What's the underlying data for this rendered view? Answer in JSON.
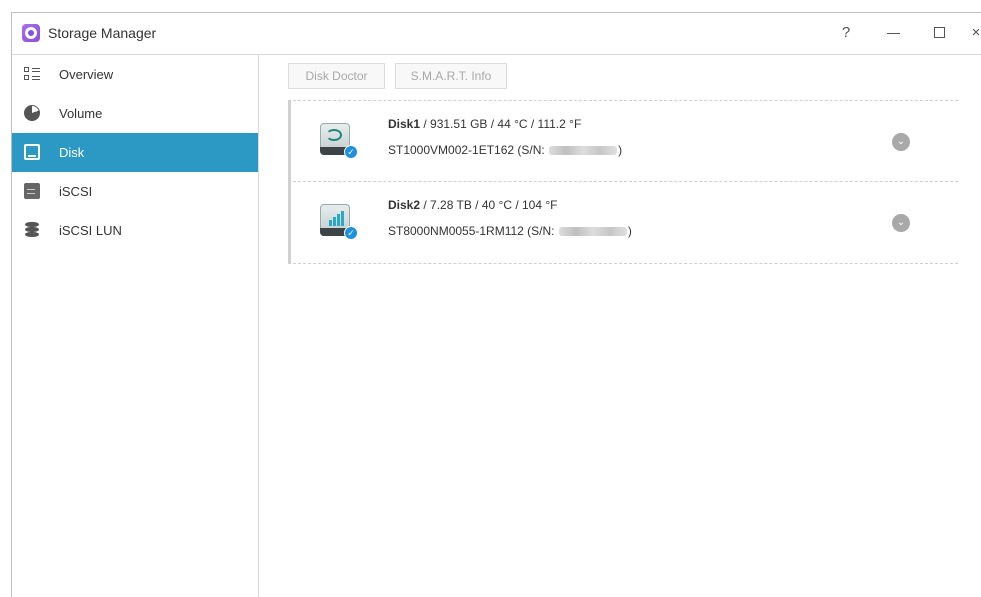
{
  "window": {
    "title": "Storage Manager",
    "controls": {
      "help": "?",
      "minimize": "",
      "maximize": "",
      "close": "×"
    }
  },
  "sidebar": {
    "items": [
      {
        "label": "Overview",
        "icon": "overview-icon",
        "active": false
      },
      {
        "label": "Volume",
        "icon": "volume-icon",
        "active": false
      },
      {
        "label": "Disk",
        "icon": "disk-icon",
        "active": true
      },
      {
        "label": "iSCSI",
        "icon": "iscsi-icon",
        "active": false
      },
      {
        "label": "iSCSI LUN",
        "icon": "iscsi-lun-icon",
        "active": false
      }
    ],
    "active_color": "#2c99c4"
  },
  "toolbar": {
    "disk_doctor": "Disk Doctor",
    "smart_info": "S.M.A.R.T. Info"
  },
  "disks": [
    {
      "name": "Disk1",
      "details": " / 931.51 GB / 44 °C / 111.2 °F",
      "model": "ST1000VM002-1ET162 (S/N:",
      "close_paren": ")"
    },
    {
      "name": "Disk2",
      "details": " / 7.28 TB / 40 °C / 104 °F",
      "model": "ST8000NM0055-1RM112 (S/N:",
      "close_paren": ")"
    }
  ]
}
